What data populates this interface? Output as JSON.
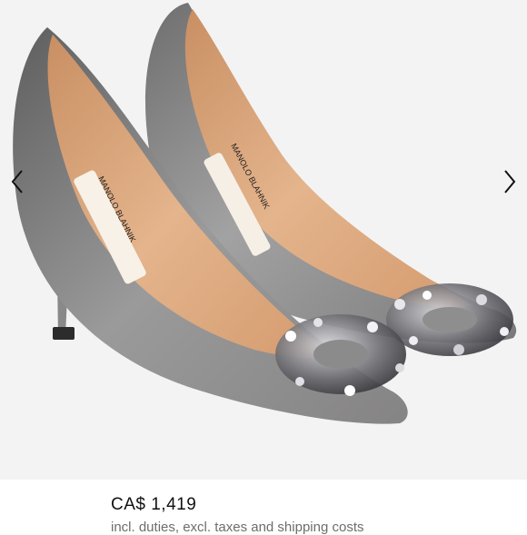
{
  "product": {
    "image_alt": "Grey satin pumps with crystal buckle",
    "brand_label_left": "MANOLO BLAHNIK",
    "brand_label_right": "MANOLO BLAHNIK",
    "price": "CA$ 1,419",
    "price_note": "incl. duties, excl. taxes and shipping costs"
  },
  "gallery": {
    "prev_icon": "chevron-left-icon",
    "next_icon": "chevron-right-icon"
  },
  "colors": {
    "background": "#f3f3f4",
    "satin": "#8c8b8b",
    "lining": "#d9a77f",
    "crystal": "#5a5a5e"
  }
}
